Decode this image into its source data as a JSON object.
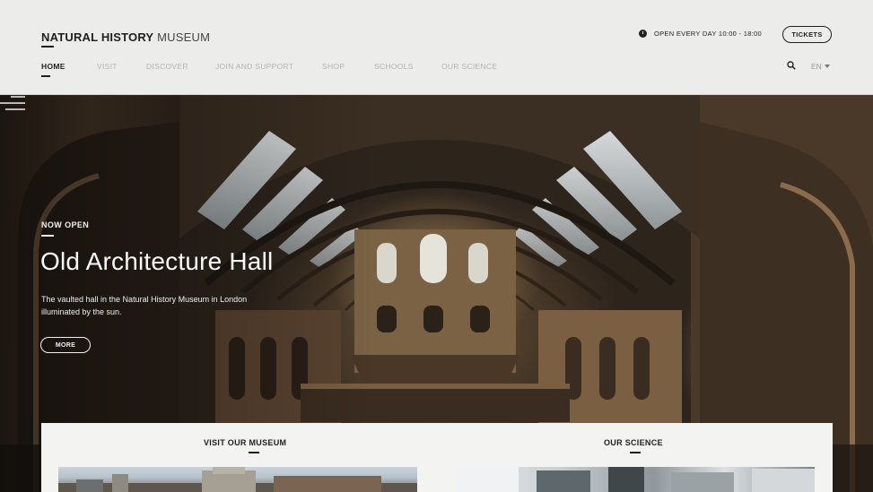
{
  "header": {
    "logo_bold": "NATURAL HISTORY",
    "logo_light": "MUSEUM",
    "hours": "OPEN EVERY DAY 10:00 - 18:00",
    "tickets_label": "TICKETS",
    "nav": [
      "HOME",
      "VISIT",
      "DISCOVER",
      "JOIN AND SUPPORT",
      "SHOP",
      "SCHOOLS",
      "OUR SCIENCE"
    ],
    "active_nav": "HOME",
    "language": "EN"
  },
  "hero": {
    "eyebrow": "NOW OPEN",
    "title": "Old Architecture Hall",
    "description": "The vaulted hall in the Natural History Museum in London illuminated by the sun.",
    "more_label": "MORE"
  },
  "sections": {
    "visit_title": "VISIT OUR MUSEUM",
    "science_title": "OUR SCIENCE"
  },
  "icons": {
    "clock": "clock-icon",
    "search": "search-icon",
    "language_caret": "chevron-down-icon",
    "menu": "menu-icon"
  },
  "colors": {
    "header_bg": "#ececeb",
    "text_dark": "#1f1f1f",
    "nav_inactive": "#b3b3b3",
    "hero_text": "#fafafa"
  }
}
